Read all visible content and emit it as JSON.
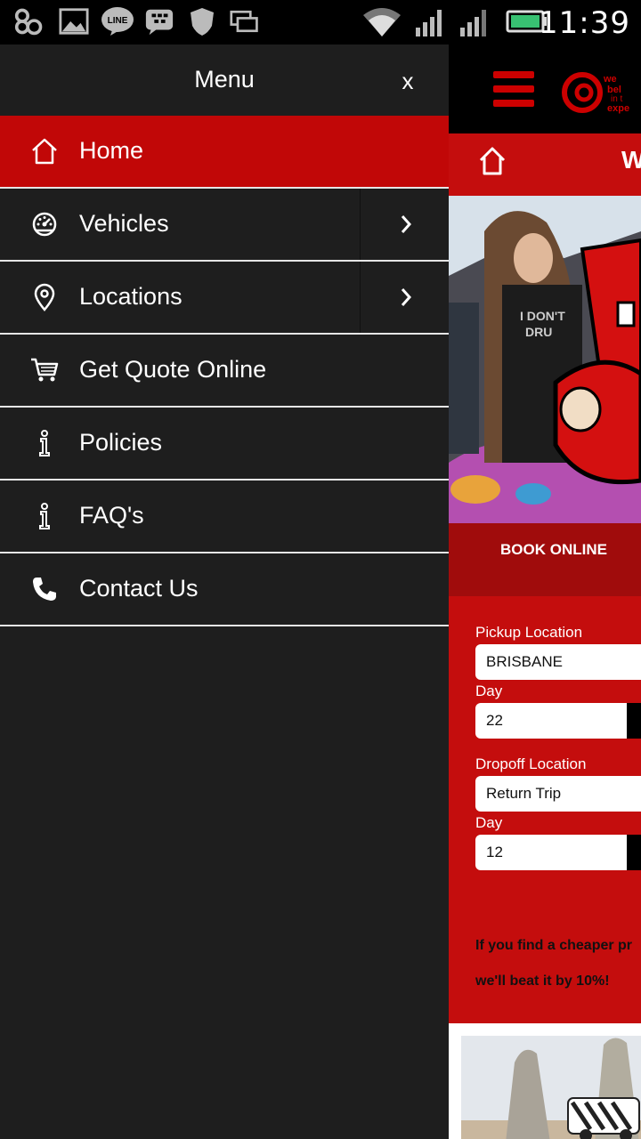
{
  "status_bar": {
    "time": "11:39",
    "icons": [
      "app-icon",
      "gallery-icon",
      "line-icon",
      "bbm-icon",
      "shield-icon",
      "multiwindow-icon",
      "wifi-icon",
      "signal-icon",
      "signal-icon",
      "battery-icon"
    ]
  },
  "drawer": {
    "title": "Menu",
    "close_label": "x",
    "items": [
      {
        "label": "Home",
        "icon": "home-icon",
        "active": true,
        "submenu": false
      },
      {
        "label": "Vehicles",
        "icon": "speedometer-icon",
        "active": false,
        "submenu": true
      },
      {
        "label": "Locations",
        "icon": "map-pin-icon",
        "active": false,
        "submenu": true
      },
      {
        "label": "Get Quote Online",
        "icon": "cart-icon",
        "active": false,
        "submenu": false
      },
      {
        "label": "Policies",
        "icon": "info-icon",
        "active": false,
        "submenu": false
      },
      {
        "label": "FAQ's",
        "icon": "info-icon",
        "active": false,
        "submenu": false
      },
      {
        "label": "Contact Us",
        "icon": "phone-icon",
        "active": false,
        "submenu": false
      }
    ]
  },
  "page": {
    "nav_text": "W",
    "book_tab": "BOOK ONLINE",
    "form": {
      "pickup_label": "Pickup Location",
      "pickup_value": "BRISBANE",
      "pickup_day_label": "Day",
      "pickup_day_value": "22",
      "dropoff_label": "Dropoff Location",
      "dropoff_value": "Return Trip",
      "dropoff_day_label": "Day",
      "dropoff_day_value": "12"
    },
    "promo_line1": "If you find a cheaper pr",
    "promo_line2": "we'll beat it by 10%!"
  },
  "colors": {
    "brand_red": "#c40d0d",
    "drawer_bg": "#1e1e1e",
    "active_item": "#c10707"
  }
}
